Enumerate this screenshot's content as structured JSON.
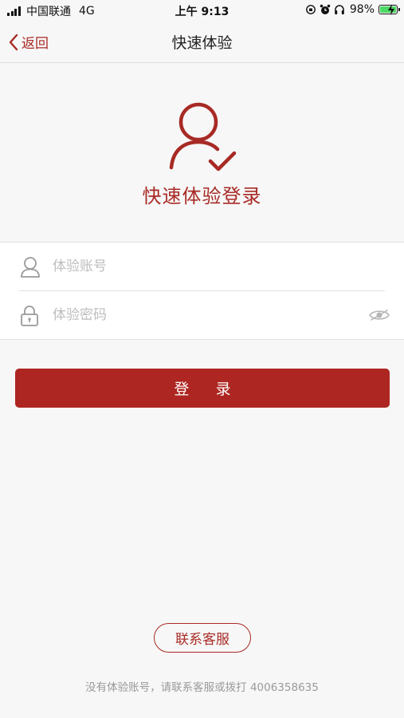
{
  "status_bar": {
    "carrier": "中国联通",
    "network": "4G",
    "time": "上午 9:13",
    "battery": "98%"
  },
  "nav": {
    "back_label": "返回",
    "title": "快速体验"
  },
  "hero": {
    "icon": "user-check-icon",
    "title": "快速体验登录"
  },
  "form": {
    "account": {
      "icon": "user-icon",
      "placeholder": "体验账号",
      "value": ""
    },
    "password": {
      "icon": "lock-icon",
      "placeholder": "体验密码",
      "value": "",
      "toggle_icon": "eye-icon"
    }
  },
  "login_button": {
    "label": "登 录"
  },
  "contact_button": {
    "label": "联系客服"
  },
  "footer": {
    "hint": "没有体验账号，请联系客服或拨打 4006358635"
  },
  "colors": {
    "accent": "#ad2621",
    "background": "#f7f7f7",
    "battery": "#4cd964"
  }
}
